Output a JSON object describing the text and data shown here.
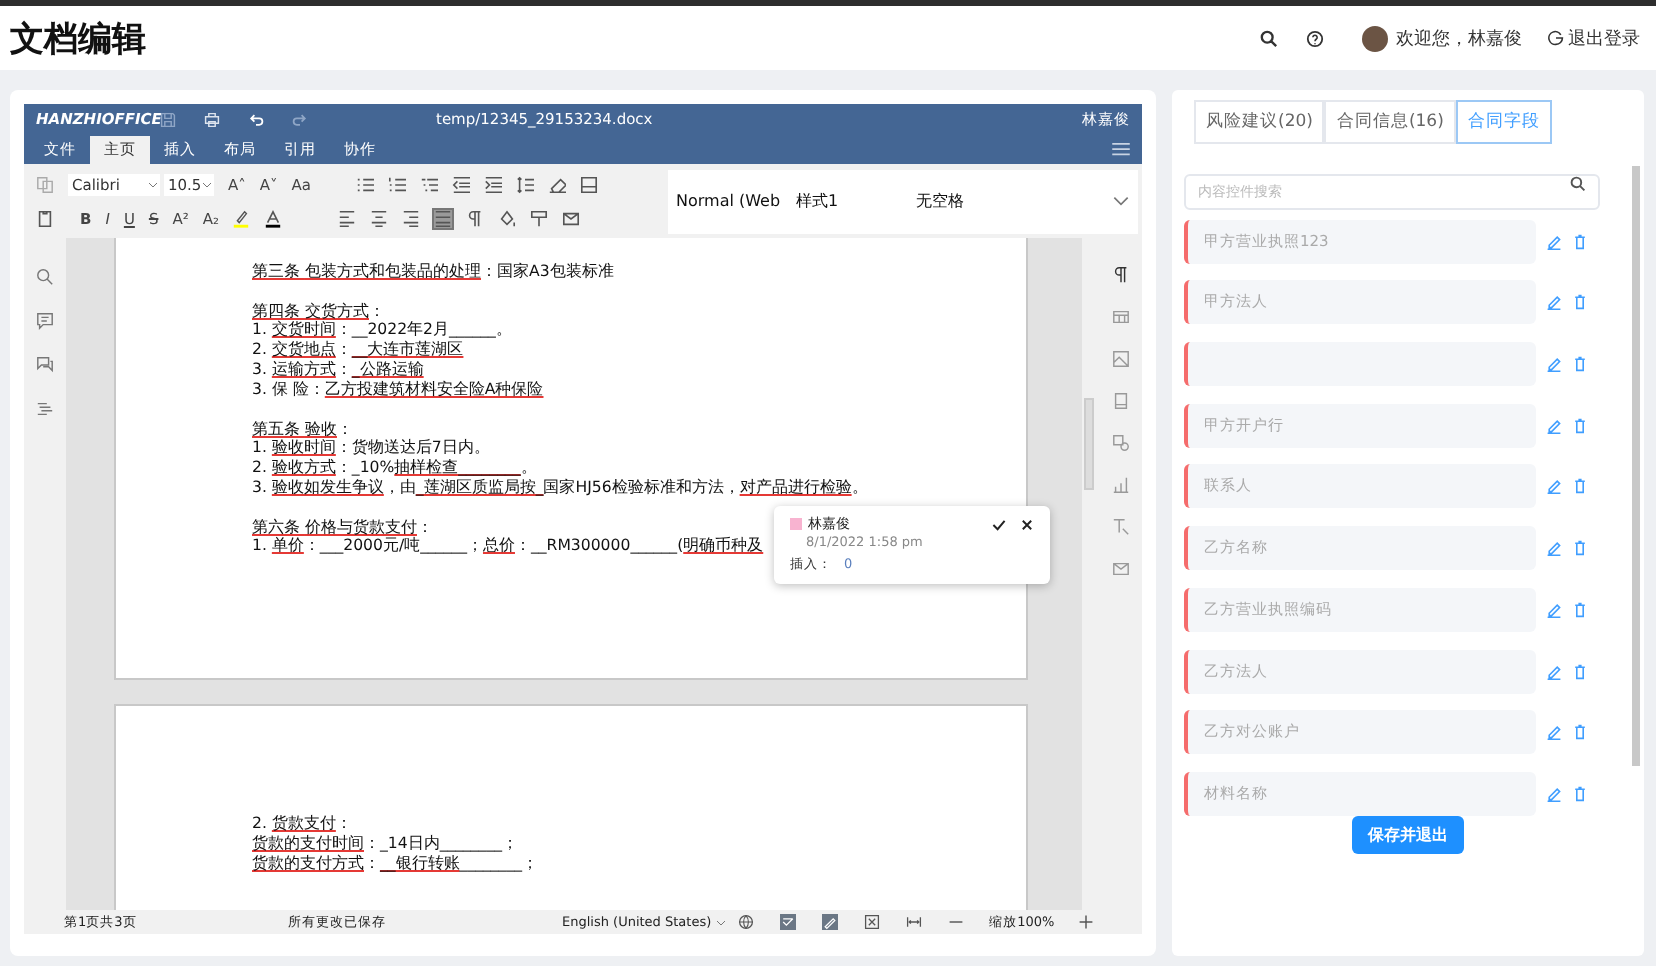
{
  "app": {
    "title": "文档编辑",
    "welcome": "欢迎您，林嘉俊",
    "logout": "退出登录"
  },
  "editor": {
    "brand": "HANZHIOFFICE",
    "file_name": "temp/12345_29153234.docx",
    "user": "林嘉俊",
    "menu_tabs": [
      {
        "label": "文件",
        "selected": false
      },
      {
        "label": "主页",
        "selected": true
      },
      {
        "label": "插入",
        "selected": false
      },
      {
        "label": "布局",
        "selected": false
      },
      {
        "label": "引用",
        "selected": false
      },
      {
        "label": "协作",
        "selected": false
      }
    ],
    "font_name": "Calibri",
    "font_size": "10.5",
    "size_glyphs": [
      "A˄",
      "A˅",
      "Aa"
    ],
    "format_glyphs": [
      "B",
      "I",
      "U",
      "S",
      "A²",
      "A₂"
    ],
    "styles": [
      "Normal (Web",
      "样式1",
      "无空格"
    ],
    "pages": [
      {
        "lines": [
          {
            "spaced": false,
            "segments": [
              {
                "text": "第三条 ",
                "flagged": true
              },
              {
                "text": "包装方式和包装品的处理",
                "flagged": true
              },
              {
                "text": "：国家A3包装标准",
                "flagged": false
              }
            ]
          },
          {
            "spaced": true,
            "segments": [
              {
                "text": "第四条 ",
                "flagged": true
              },
              {
                "text": "交货方式",
                "flagged": true
              },
              {
                "text": "：",
                "flagged": false
              }
            ]
          },
          {
            "spaced": false,
            "segments": [
              {
                "text": "1. ",
                "flagged": false
              },
              {
                "text": "交货时间",
                "flagged": true
              },
              {
                "text": "：__2022年2月______。",
                "flagged": false
              }
            ]
          },
          {
            "spaced": false,
            "segments": [
              {
                "text": "2. ",
                "flagged": false
              },
              {
                "text": "交货地点",
                "flagged": true
              },
              {
                "text": "：",
                "flagged": false
              },
              {
                "text": "__大连市莲湖区",
                "flagged": true
              }
            ]
          },
          {
            "spaced": false,
            "segments": [
              {
                "text": "3. ",
                "flagged": false
              },
              {
                "text": "运输方式",
                "flagged": true
              },
              {
                "text": "：",
                "flagged": false
              },
              {
                "text": "_公路运输",
                "flagged": true
              }
            ]
          },
          {
            "spaced": false,
            "segments": [
              {
                "text": "3.    保 险：",
                "flagged": false
              },
              {
                "text": "乙方投建筑材料安全险A种保险",
                "flagged": true
              }
            ]
          },
          {
            "spaced": true,
            "segments": [
              {
                "text": "第五条 ",
                "flagged": true
              },
              {
                "text": "验收",
                "flagged": true
              },
              {
                "text": "：",
                "flagged": false
              }
            ]
          },
          {
            "spaced": false,
            "segments": [
              {
                "text": "1. ",
                "flagged": false
              },
              {
                "text": "验收时间",
                "flagged": true
              },
              {
                "text": "：货物送达后7日内。",
                "flagged": false
              }
            ]
          },
          {
            "spaced": false,
            "segments": [
              {
                "text": "2. ",
                "flagged": false
              },
              {
                "text": "验收方式",
                "flagged": true
              },
              {
                "text": "：_10%",
                "flagged": false
              },
              {
                "text": "抽样检查________",
                "flagged": true
              },
              {
                "text": "。",
                "flagged": false
              }
            ]
          },
          {
            "spaced": false,
            "segments": [
              {
                "text": "3. ",
                "flagged": false
              },
              {
                "text": "验收如发生争议",
                "flagged": true
              },
              {
                "text": "，由",
                "flagged": false
              },
              {
                "text": "_莲湖区质监局按_",
                "flagged": true
              },
              {
                "text": "国家HJ56检验标准和方法，",
                "flagged": false
              },
              {
                "text": "对产品进行检验",
                "flagged": true
              },
              {
                "text": "。",
                "flagged": false
              }
            ]
          },
          {
            "spaced": true,
            "segments": [
              {
                "text": "第六条 ",
                "flagged": true
              },
              {
                "text": "价格与货款支付",
                "flagged": true
              },
              {
                "text": "：",
                "flagged": false
              }
            ]
          },
          {
            "spaced": false,
            "segments": [
              {
                "text": "1. ",
                "flagged": false
              },
              {
                "text": "单价",
                "flagged": true
              },
              {
                "text": "：___2000元/吨______；",
                "flagged": false
              },
              {
                "text": "总价",
                "flagged": true
              },
              {
                "text": "：__RM300000______(",
                "flagged": false
              },
              {
                "text": "明确币种及",
                "flagged": true
              }
            ]
          }
        ]
      },
      {
        "lines": [
          {
            "spaced": false,
            "segments": [
              {
                "text": "2. ",
                "flagged": false
              },
              {
                "text": "货款支付",
                "flagged": true
              },
              {
                "text": "：",
                "flagged": false
              }
            ]
          },
          {
            "spaced": false,
            "segments": [
              {
                "text": "货款的支付时间",
                "flagged": true
              },
              {
                "text": "：_14日内________；",
                "flagged": false
              }
            ]
          },
          {
            "spaced": false,
            "segments": [
              {
                "text": "货款的支付方式",
                "flagged": true
              },
              {
                "text": "：",
                "flagged": false
              },
              {
                "text": "__银行转账",
                "flagged": true
              },
              {
                "text": "________；",
                "flagged": false
              }
            ]
          }
        ]
      }
    ],
    "comment": {
      "author": "林嘉俊",
      "date": "8/1/2022 1:58 pm",
      "label": "插入：",
      "value": "0"
    },
    "status": {
      "page": "第1页共3页",
      "saved": "所有更改已保存",
      "language": "English (United States)",
      "zoom": "缩放100%"
    }
  },
  "panel": {
    "tabs": [
      {
        "label": "风险建议(20)",
        "selected": false
      },
      {
        "label": "合同信息(16)",
        "selected": false
      },
      {
        "label": "合同字段",
        "selected": true
      }
    ],
    "search": {
      "placeholder": "内容控件搜索"
    },
    "fields": [
      {
        "kind": "text",
        "label": "甲方营业执照123"
      },
      {
        "kind": "text",
        "label": "甲方法人"
      },
      {
        "kind": "blank"
      },
      {
        "kind": "text",
        "label": "甲方开户行"
      },
      {
        "kind": "text",
        "label": "联系人"
      },
      {
        "kind": "text",
        "label": "乙方名称"
      },
      {
        "kind": "text",
        "label": "乙方营业执照编码"
      },
      {
        "kind": "text",
        "label": "乙方法人"
      },
      {
        "kind": "text",
        "label": "乙方对公账户"
      },
      {
        "kind": "text",
        "label": "材料名称"
      }
    ],
    "save_button": "保存并退出"
  }
}
